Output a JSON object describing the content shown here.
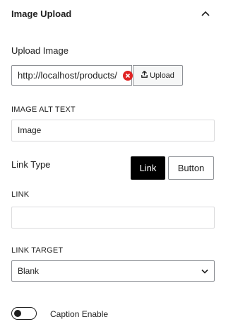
{
  "panel": {
    "title": "Image Upload"
  },
  "upload": {
    "label": "Upload Image",
    "url_value": "http://localhost/products/",
    "button_label": "Upload"
  },
  "alt_text": {
    "label": "IMAGE ALT TEXT",
    "value": "Image"
  },
  "link_type": {
    "label": "Link Type",
    "options": [
      "Link",
      "Button"
    ],
    "selected": "Link"
  },
  "link": {
    "label": "LINK",
    "value": ""
  },
  "link_target": {
    "label": "LINK TARGET",
    "selected": "Blank"
  },
  "caption": {
    "label": "Caption Enable",
    "enabled": false
  },
  "colors": {
    "clear_icon": "#e02424",
    "active_button": "#000000"
  },
  "icons": {
    "collapse": "chevron-up-icon",
    "clear": "clear-icon",
    "upload": "upload-icon",
    "select": "chevron-down-icon"
  }
}
